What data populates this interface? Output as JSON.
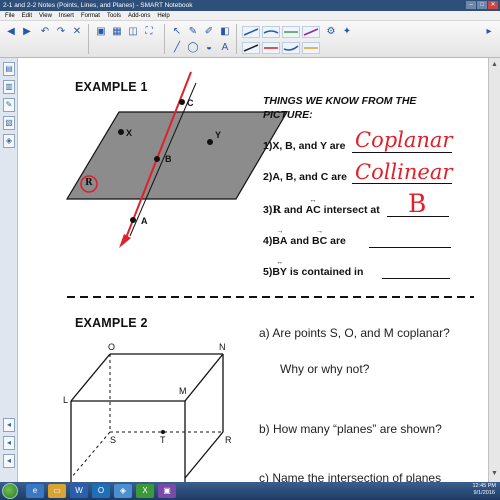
{
  "window": {
    "title": "2-1 and 2-2 Notes (Points, Lines, and Planes) - SMART Notebook",
    "controls": [
      "–",
      "□",
      "✕"
    ]
  },
  "menu": [
    "File",
    "Edit",
    "View",
    "Insert",
    "Format",
    "Tools",
    "Add-ons",
    "Help"
  ],
  "example1": {
    "title": "EXAMPLE 1",
    "heading": "THINGS WE KNOW FROM THE PICTURE:",
    "point_labels": [
      "X",
      "Y",
      "B",
      "C",
      "A"
    ],
    "plane_label": "R",
    "items": [
      {
        "text": "1)X, B, and Y are",
        "answer": "Coplanar"
      },
      {
        "text": "2)A, B, and C are",
        "answer": "Collinear"
      },
      {
        "text_before": "3)",
        "plane": "R",
        "text_mid": " and ",
        "line": "AC",
        "text_after": " intersect at",
        "answer": "B"
      },
      {
        "text_before": "4)",
        "ray1": "BA",
        "text_mid": " and ",
        "ray2": "BC",
        "text_after": " are"
      },
      {
        "text_before": "5)",
        "line": "BY",
        "text_after": " is contained in"
      }
    ]
  },
  "example2": {
    "title": "EXAMPLE 2",
    "q_a": "a)  Are points S, O, and M coplanar?",
    "q_a_follow": "Why or why not?",
    "q_b": "b)  How many “planes” are shown?",
    "q_c": "c)  Name the intersection of planes",
    "box_labels": [
      "O",
      "N",
      "M",
      "L",
      "S",
      "T",
      "R"
    ]
  },
  "taskbar": {
    "time": "12:45 PM",
    "date": "9/1/2016"
  },
  "colors": {
    "ink_red": "#e0202a",
    "plane_gray": "#8c8c8c",
    "titlebar": "#2e4f7a"
  }
}
